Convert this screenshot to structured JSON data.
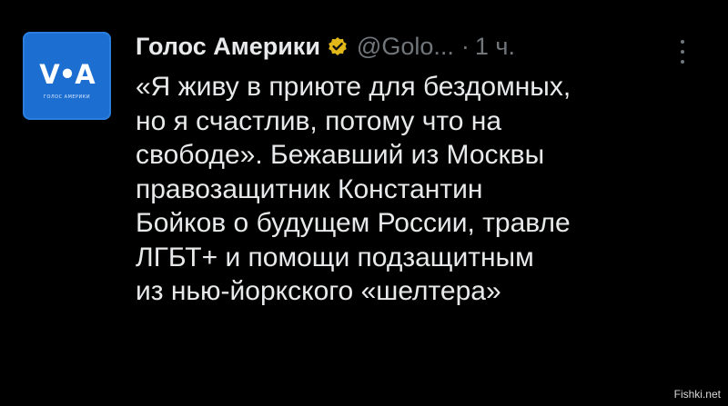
{
  "account": {
    "avatar_logo": "V•A",
    "avatar_caption": "ГОЛОС АМЕРИКИ",
    "display_name": "Голос Америки",
    "handle": "@Golo...",
    "separator": "·",
    "time": "1 ч.",
    "badge_color": "#e2b719",
    "avatar_color": "#1c6fd1",
    "more_icon": "three-dots-vertical-icon"
  },
  "tweet": {
    "lines": [
      "«Я живу в приюте для бездомных,",
      "но я счастлив, потому что на",
      "свободе». Бежавший из Москвы",
      "правозащитник Константин",
      "Бойков о будущем России, травле",
      "ЛГБТ+ и помощи подзащитным",
      "из нью-йоркского «шелтера»"
    ]
  },
  "watermark": "Fishki.net"
}
